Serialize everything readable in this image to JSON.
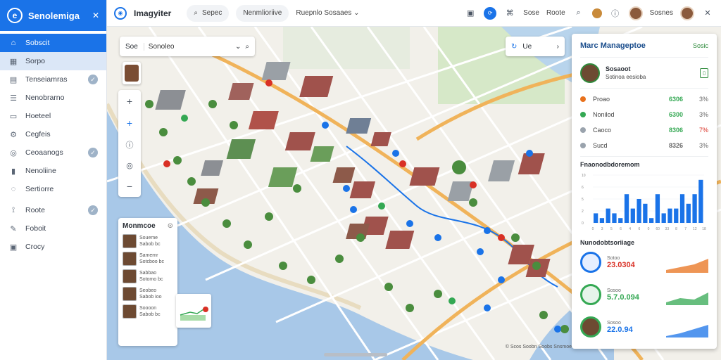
{
  "sidebar": {
    "brand_title": "Senolemiga",
    "items": [
      {
        "label": "Sobscit",
        "icon": "home-icon",
        "state": "active",
        "check": false
      },
      {
        "label": "Sorpo",
        "icon": "grid-icon",
        "state": "selected",
        "check": false
      },
      {
        "label": "Tenseiamras",
        "icon": "document-icon",
        "state": "",
        "check": true
      },
      {
        "label": "Nenobrarno",
        "icon": "list-icon",
        "state": "",
        "check": false
      },
      {
        "label": "Hoeteel",
        "icon": "calendar-icon",
        "state": "",
        "check": false
      },
      {
        "label": "Cegfeis",
        "icon": "gear-icon",
        "state": "",
        "check": false
      },
      {
        "label": "Ceoaanogs",
        "icon": "users-icon",
        "state": "",
        "check": true
      },
      {
        "label": "Nenoliine",
        "icon": "chart-icon",
        "state": "",
        "check": false
      },
      {
        "label": "Sertiorre",
        "icon": "settings-icon",
        "state": "",
        "check": false
      },
      {
        "label": "Roote",
        "icon": "route-icon",
        "state": "",
        "check": true
      },
      {
        "label": "Foboit",
        "icon": "pen-icon",
        "state": "",
        "check": false
      },
      {
        "label": "Crocy",
        "icon": "clipboard-icon",
        "state": "",
        "check": false
      }
    ]
  },
  "topbar": {
    "app_title": "Imagyiter",
    "search_pill": "Sepec",
    "nav_pill": "Nenmlioriive",
    "dropdown": "Ruepnlo Sosaaes",
    "link_a": "Sose",
    "link_b": "Roote",
    "user_name": "Sosnes"
  },
  "map_overlay": {
    "search_select": "Soe",
    "search_value": "Sonoleo",
    "route_label": "Ue",
    "members_title": "Monmcoe",
    "members": [
      {
        "line1": "Soueme",
        "line2": "Sabob bc"
      },
      {
        "line1": "Samemr",
        "line2": "Sotcboo bc"
      },
      {
        "line1": "Sabbao",
        "line2": "Sotomo bc"
      },
      {
        "line1": "Seobeo",
        "line2": "Sabob ioo"
      },
      {
        "line1": "Soooon",
        "line2": "Sabob bc"
      }
    ],
    "attribution": "© Scos Soobn Soobs Snsmoe"
  },
  "panel": {
    "title": "Marc Manageptoe",
    "action": "Sosic",
    "user_name": "Sosaoot",
    "user_line": "Sotinoa eesioba",
    "stats": [
      {
        "label": "Proao",
        "v1": "6306",
        "v2": "3%",
        "dot": "#e8711c",
        "v1color": "#34a853",
        "v2color": "#666"
      },
      {
        "label": "Nonilod",
        "v1": "6300",
        "v2": "3%",
        "dot": "#34a853",
        "v1color": "#34a853",
        "v2color": "#666"
      },
      {
        "label": "Caoco",
        "v1": "8306",
        "v2": "7%",
        "dot": "#9aa3ad",
        "v1color": "#34a853",
        "v2color": "#d93025"
      },
      {
        "label": "Sucd",
        "v1": "8326",
        "v2": "3%",
        "dot": "#9aa3ad",
        "v1color": "#666",
        "v2color": "#666"
      }
    ],
    "bar_title": "Fnaonodbdoremom",
    "kpi_title": "Nunodobtsoriiage",
    "kpis": [
      {
        "label": "Sotoo",
        "value": "23.0304",
        "color": "#d93025",
        "icon": "clock-icon",
        "circ": ""
      },
      {
        "label": "Sosoo",
        "value": "5.7.0.094",
        "color": "#34a853",
        "icon": "timer-icon",
        "circ": "green"
      },
      {
        "label": "Sosoo",
        "value": "22.0.94",
        "color": "#1a73e8",
        "icon": "user-photo-icon",
        "circ": "ph"
      }
    ]
  },
  "chart_data": {
    "type": "bar",
    "categories": [
      "1",
      "2",
      "3",
      "4",
      "5",
      "6",
      "7",
      "8",
      "9",
      "10",
      "11",
      "12",
      "13",
      "14",
      "15",
      "16",
      "17",
      "18"
    ],
    "values": [
      2,
      1,
      3,
      2,
      1,
      6,
      3,
      5,
      4,
      1,
      6,
      2,
      3,
      3,
      6,
      4,
      6,
      9
    ],
    "ylim": [
      0,
      10
    ],
    "yticks": [
      "10",
      "6",
      "5",
      "2",
      "0"
    ],
    "xticks": [
      "0",
      "3",
      "5",
      "6",
      "4",
      "6",
      "0",
      "60",
      "33",
      "8",
      "7",
      "12",
      "18"
    ],
    "color": "#1a73e8"
  },
  "colors": {
    "accent": "#1a73e8",
    "water": "#a8c8e8",
    "park": "#cfe3c0",
    "road_major": "#f0b35a"
  }
}
